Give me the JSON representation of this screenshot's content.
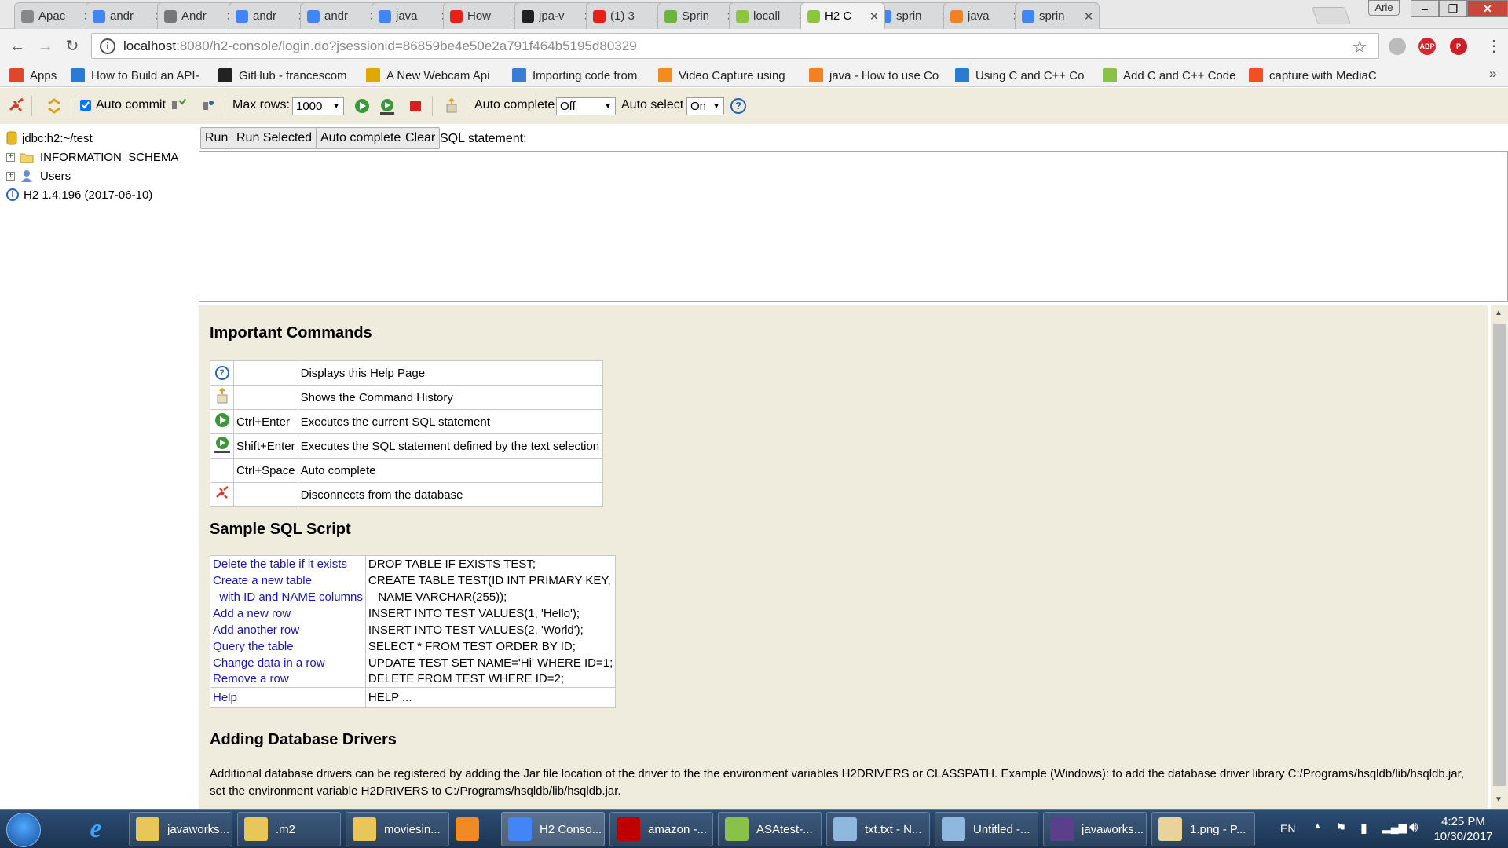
{
  "browser": {
    "tabs": [
      {
        "title": "Apac",
        "favicon": "document-icon",
        "color": "#888888"
      },
      {
        "title": "andr",
        "favicon": "google-icon",
        "color": "#4285f4"
      },
      {
        "title": "Andr",
        "favicon": "j-icon",
        "color": "#777777"
      },
      {
        "title": "andr",
        "favicon": "google-icon",
        "color": "#4285f4"
      },
      {
        "title": "andr",
        "favicon": "google-icon",
        "color": "#4285f4"
      },
      {
        "title": "java",
        "favicon": "google-icon",
        "color": "#4285f4"
      },
      {
        "title": "How",
        "favicon": "youtube-icon",
        "color": "#e62117"
      },
      {
        "title": "jpa-v",
        "favicon": "github-icon",
        "color": "#222222"
      },
      {
        "title": "(1) 3",
        "favicon": "youtube-icon",
        "color": "#e62117"
      },
      {
        "title": "Sprin",
        "favicon": "spring-icon",
        "color": "#6db33f"
      },
      {
        "title": "locall",
        "favicon": "leaf-icon",
        "color": "#8cc63f"
      },
      {
        "title": "H2 C",
        "favicon": "leaf-icon",
        "color": "#8cc63f"
      },
      {
        "title": "sprin",
        "favicon": "google-icon",
        "color": "#4285f4"
      },
      {
        "title": "java",
        "favicon": "stackoverflow-icon",
        "color": "#f48024"
      },
      {
        "title": "sprin",
        "favicon": "google-icon",
        "color": "#4285f4"
      }
    ],
    "profile": "Arie",
    "url_host": "localhost",
    "url_path": ":8080/h2-console/login.do?jsessionid=86859be4e50e2a791f464b5195d80329",
    "extensions": [
      {
        "name": "pocket-icon",
        "label": "",
        "color": "#bbbbbb"
      },
      {
        "name": "adblock-icon",
        "label": "ABP",
        "color": "#d9232a"
      },
      {
        "name": "pinterest-icon",
        "label": "P",
        "color": "#cb2027"
      },
      {
        "name": "extension-icon",
        "label": "▲",
        "color": "#d9232a"
      }
    ],
    "bookmarks": [
      {
        "label": "Apps",
        "icon": "apps-icon",
        "color": "#e0462c"
      },
      {
        "label": "How to Build an API-",
        "icon": "bookmark-arrow-icon",
        "color": "#2a7bd4"
      },
      {
        "label": "GitHub - francescom",
        "icon": "github-icon",
        "color": "#222222"
      },
      {
        "label": "A New Webcam Api",
        "icon": "dzone-icon",
        "color": "#e0a800"
      },
      {
        "label": "Importing code from",
        "icon": "filter-icon",
        "color": "#3b7bd4"
      },
      {
        "label": "Video Capture using",
        "icon": "codeproject-icon",
        "color": "#f28c1e"
      },
      {
        "label": "java - How to use Co",
        "icon": "stackoverflow-icon",
        "color": "#f48024"
      },
      {
        "label": "Using C and C++ Co",
        "icon": "bookmark-arrow-icon",
        "color": "#2a7bd4"
      },
      {
        "label": "Add C and C++ Code",
        "icon": "android-icon",
        "color": "#8ac249"
      },
      {
        "label": "capture with MediaC",
        "icon": "windows-icon",
        "color": "#f25022"
      }
    ]
  },
  "h2toolbar": {
    "auto_commit_label": "Auto commit",
    "auto_commit_checked": true,
    "max_rows_label": "Max rows:",
    "max_rows_value": "1000",
    "auto_complete_label": "Auto complete",
    "auto_complete_value": "Off",
    "auto_select_label": "Auto select",
    "auto_select_value": "On"
  },
  "tree": {
    "connection": "jdbc:h2:~/test",
    "items": [
      {
        "label": "INFORMATION_SCHEMA",
        "icon": "folder-icon"
      },
      {
        "label": "Users",
        "icon": "users-icon"
      }
    ],
    "version": "H2 1.4.196 (2017-06-10)"
  },
  "query": {
    "run": "Run",
    "run_selected": "Run Selected",
    "auto_complete": "Auto complete",
    "clear": "Clear",
    "sql_label": "SQL statement:",
    "sql_value": ""
  },
  "help": {
    "important_title": "Important Commands",
    "commands": [
      {
        "icon": "help-icon",
        "key": "",
        "desc": "Displays this Help Page"
      },
      {
        "icon": "history-icon",
        "key": "",
        "desc": "Shows the Command History"
      },
      {
        "icon": "run-icon",
        "key": "Ctrl+Enter",
        "desc": "Executes the current SQL statement"
      },
      {
        "icon": "run-selected-icon",
        "key": "Shift+Enter",
        "desc": "Executes the SQL statement defined by the text selection"
      },
      {
        "icon": "",
        "key": "Ctrl+Space",
        "desc": "Auto complete"
      },
      {
        "icon": "disconnect-icon",
        "key": "",
        "desc": "Disconnects from the database"
      }
    ],
    "sample_title": "Sample SQL Script",
    "sample": [
      {
        "link": "Delete the table if it exists",
        "sql": "DROP TABLE IF EXISTS TEST;"
      },
      {
        "link": "Create a new table",
        "sql": "CREATE TABLE TEST(ID INT PRIMARY KEY,"
      },
      {
        "link": "  with ID and NAME columns",
        "sql": "   NAME VARCHAR(255));"
      },
      {
        "link": "Add a new row",
        "sql": "INSERT INTO TEST VALUES(1, 'Hello');"
      },
      {
        "link": "Add another row",
        "sql": "INSERT INTO TEST VALUES(2, 'World');"
      },
      {
        "link": "Query the table",
        "sql": "SELECT * FROM TEST ORDER BY ID;"
      },
      {
        "link": "Change data in a row",
        "sql": "UPDATE TEST SET NAME='Hi' WHERE ID=1;"
      },
      {
        "link": "Remove a row",
        "sql": "DELETE FROM TEST WHERE ID=2;"
      }
    ],
    "help_link": "Help",
    "help_sql": "HELP ...",
    "drivers_title": "Adding Database Drivers",
    "drivers_text": "Additional database drivers can be registered by adding the Jar file location of the driver to the the environment variables H2DRIVERS or CLASSPATH. Example (Windows): to add the database driver library C:/Programs/hsqldb/lib/hsqldb.jar, set the environment variable H2DRIVERS to C:/Programs/hsqldb/lib/hsqldb.jar."
  },
  "taskbar": {
    "tasks": [
      {
        "label": "javaworks...",
        "icon": "folder-icon",
        "color": "#e8c65a"
      },
      {
        "label": ".m2",
        "icon": "folder-icon",
        "color": "#e8c65a"
      },
      {
        "label": "moviesin...",
        "icon": "folder-icon",
        "color": "#e8c65a"
      },
      {
        "label": "H2 Conso...",
        "icon": "chrome-icon",
        "color": "#4285f4"
      },
      {
        "label": "amazon -...",
        "icon": "filezilla-icon",
        "color": "#bf0000"
      },
      {
        "label": "ASAtest-...",
        "icon": "android-studio-icon",
        "color": "#8ac249"
      },
      {
        "label": "txt.txt - N...",
        "icon": "notepad-icon",
        "color": "#8fb8de"
      },
      {
        "label": "Untitled -...",
        "icon": "notepad-icon",
        "color": "#8fb8de"
      },
      {
        "label": "javaworks...",
        "icon": "eclipse-icon",
        "color": "#5b3f8a"
      },
      {
        "label": "1.png - P...",
        "icon": "paint-icon",
        "color": "#e9d39b"
      }
    ],
    "language": "EN",
    "time": "4:25 PM",
    "date": "10/30/2017"
  }
}
